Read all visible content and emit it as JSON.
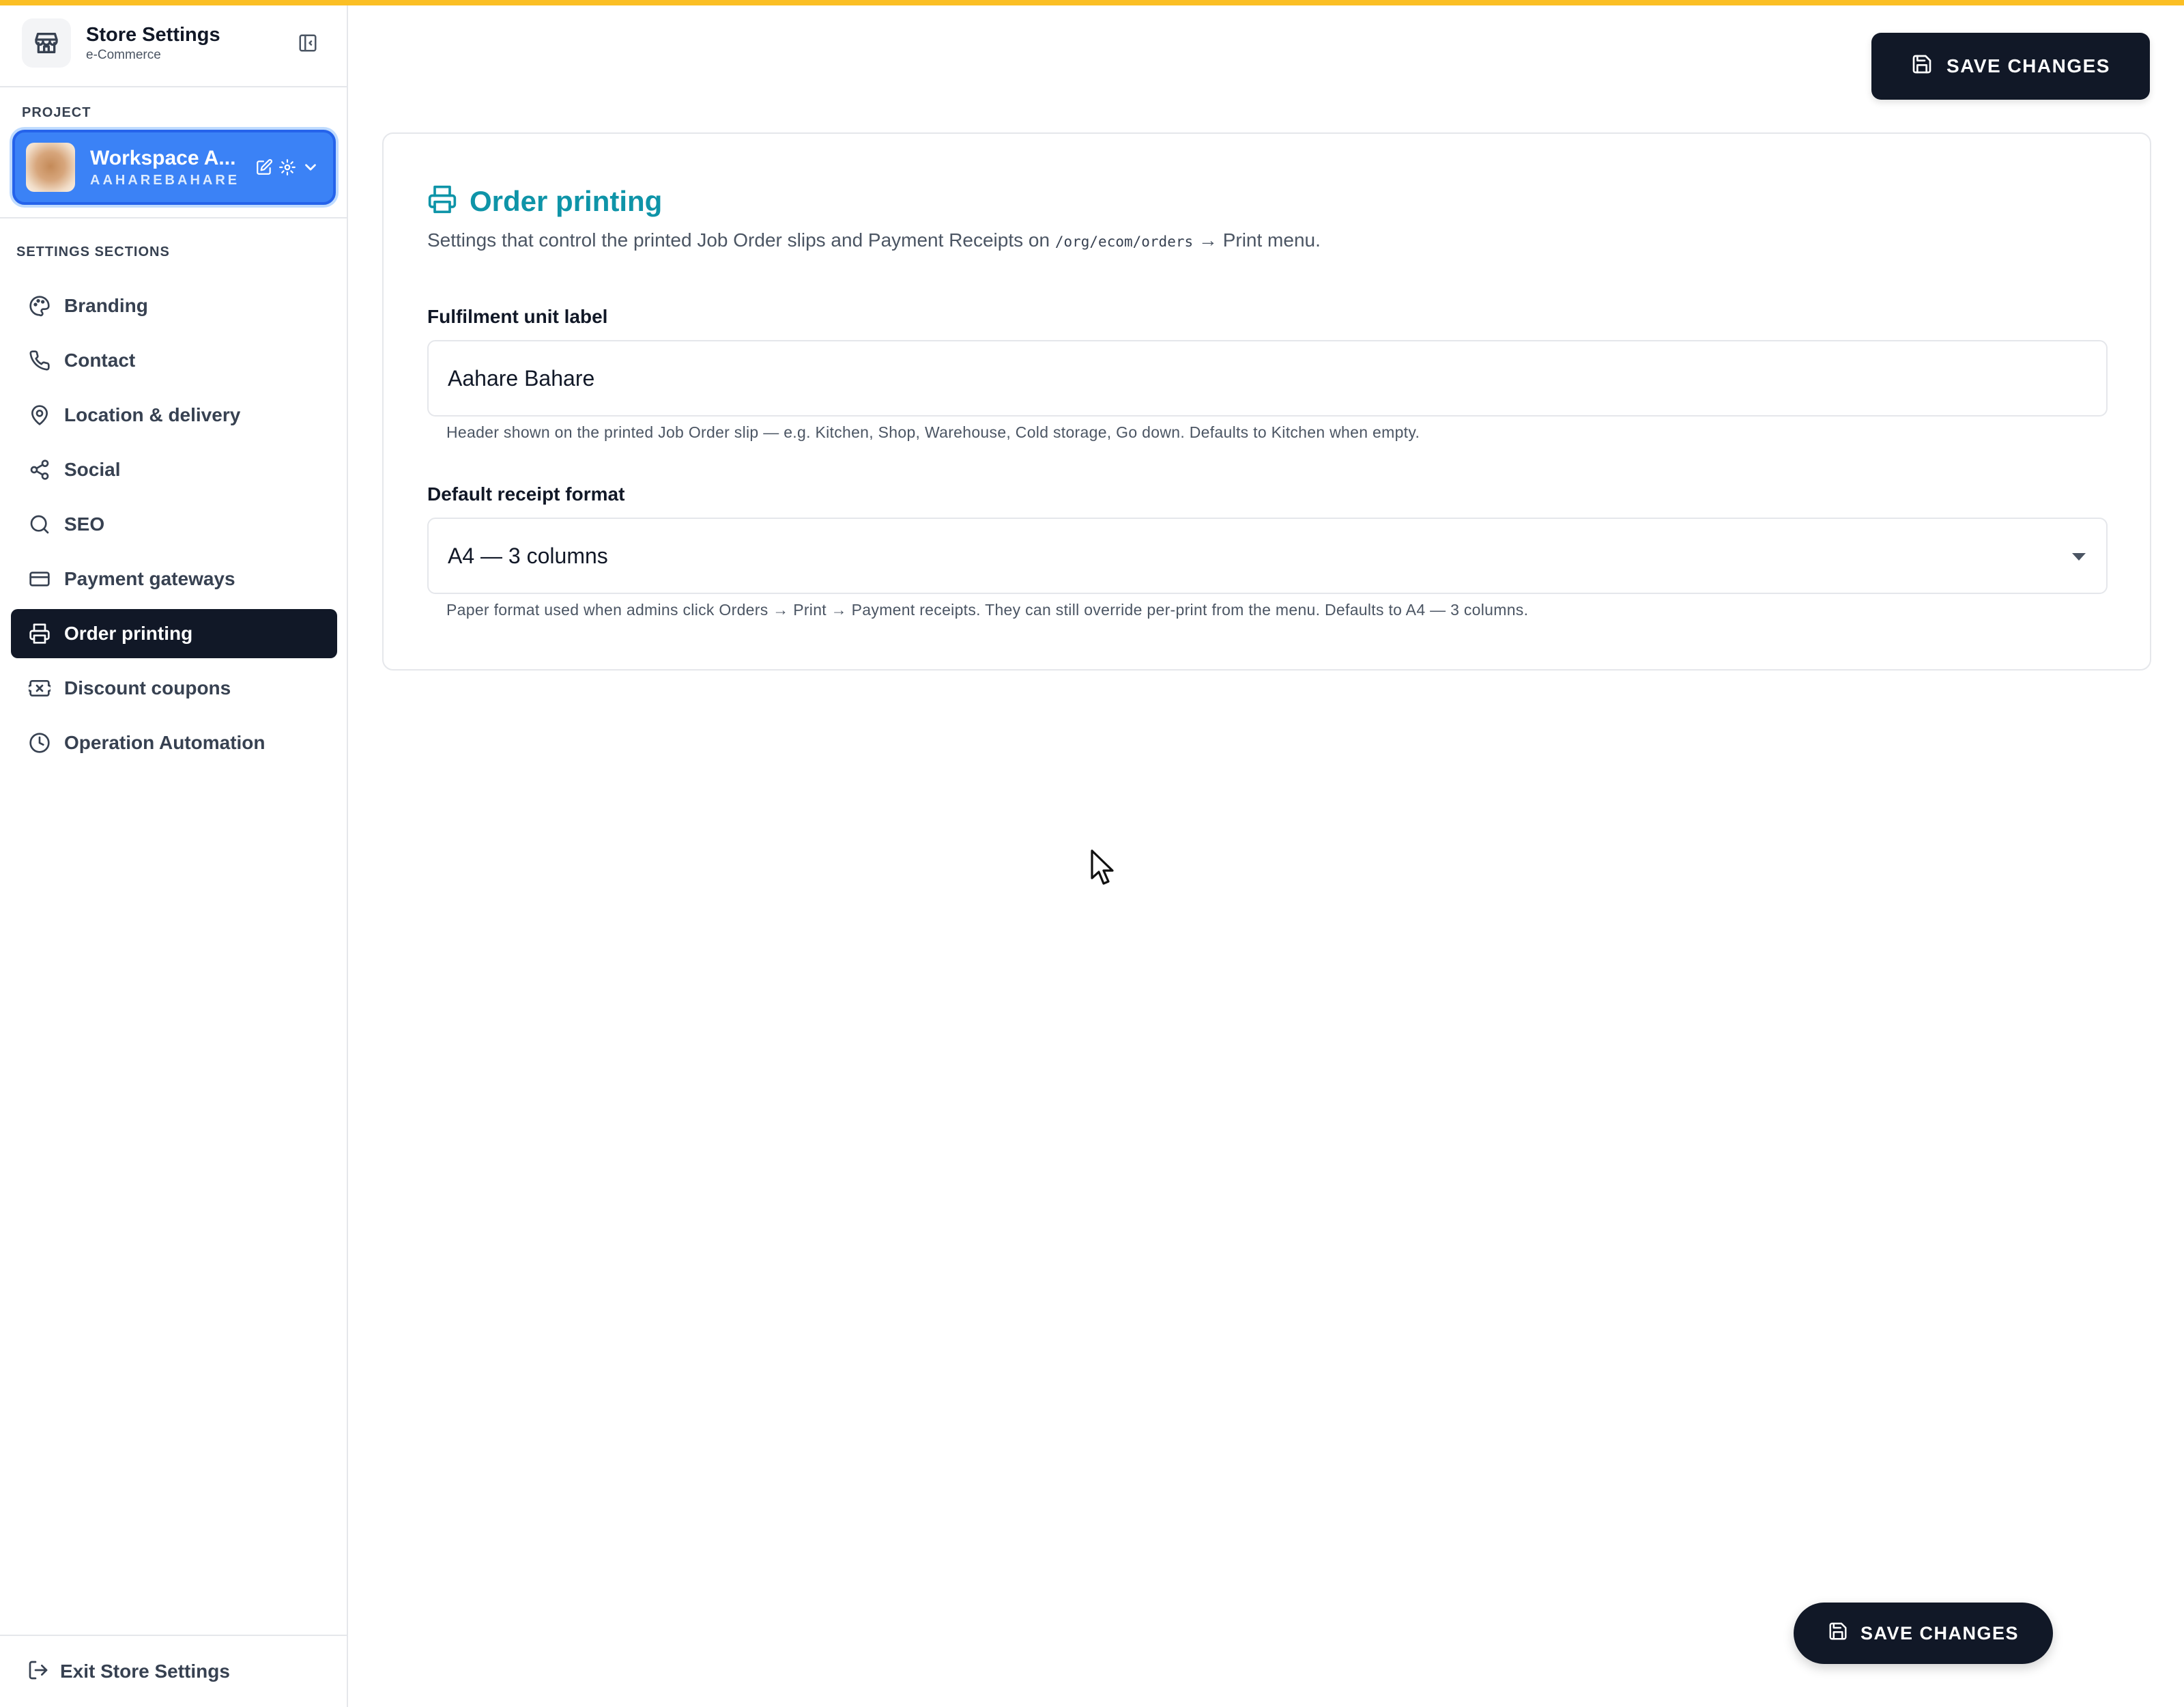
{
  "sidebar": {
    "title": "Store Settings",
    "subtitle": "e-Commerce",
    "project_label": "PROJECT",
    "project": {
      "name": "Workspace A...",
      "slug": "AAHAREBAHARE"
    },
    "sections_label": "SETTINGS SECTIONS",
    "items": [
      {
        "label": "Branding",
        "icon": "palette-icon",
        "active": false
      },
      {
        "label": "Contact",
        "icon": "phone-icon",
        "active": false
      },
      {
        "label": "Location & delivery",
        "icon": "map-pin-icon",
        "active": false
      },
      {
        "label": "Social",
        "icon": "share-icon",
        "active": false
      },
      {
        "label": "SEO",
        "icon": "search-icon",
        "active": false
      },
      {
        "label": "Payment gateways",
        "icon": "credit-card-icon",
        "active": false
      },
      {
        "label": "Order printing",
        "icon": "printer-icon",
        "active": true
      },
      {
        "label": "Discount coupons",
        "icon": "ticket-icon",
        "active": false
      },
      {
        "label": "Operation Automation",
        "icon": "clock-icon",
        "active": false
      }
    ],
    "exit_label": "Exit Store Settings"
  },
  "toolbar": {
    "save_label": "SAVE CHANGES"
  },
  "main": {
    "title": "Order printing",
    "description_prefix": "Settings that control the printed Job Order slips and Payment Receipts on ",
    "description_code": "/org/ecom/orders",
    "description_suffix": " → Print menu.",
    "fulfilment": {
      "label": "Fulfilment unit label",
      "value": "Aahare Bahare",
      "help": "Header shown on the printed Job Order slip — e.g. Kitchen, Shop, Warehouse, Cold storage, Go down. Defaults to Kitchen when empty."
    },
    "receipt_format": {
      "label": "Default receipt format",
      "selected": "A4 — 3 columns",
      "help": "Paper format used when admins click Orders → Print → Payment receipts. They can still override per-print from the menu. Defaults to A4 — 3 columns."
    }
  },
  "floating": {
    "save_label": "SAVE CHANGES"
  },
  "colors": {
    "accent_bar": "#fbbf24",
    "project_card": "#3b82f6",
    "active_nav": "#111827",
    "title_teal": "#0e94a8"
  }
}
